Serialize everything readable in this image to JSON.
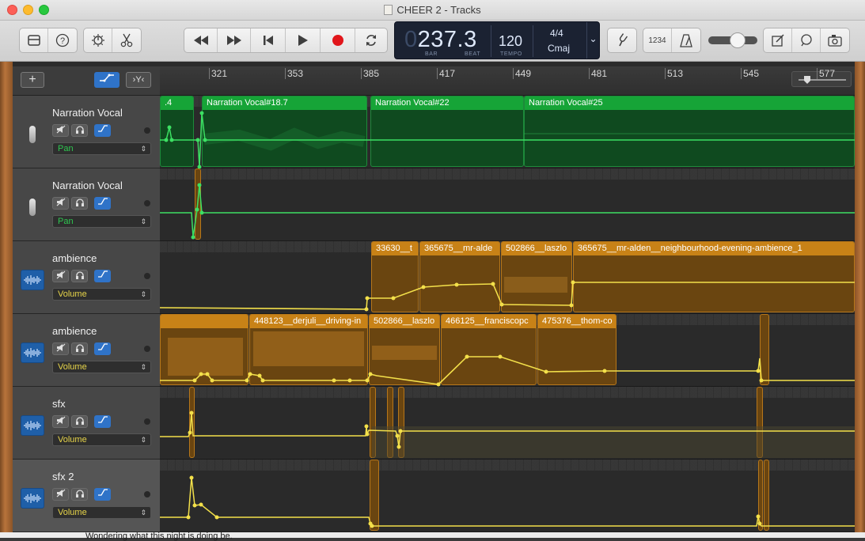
{
  "window": {
    "title": "CHEER 2 - Tracks"
  },
  "lcd": {
    "position_dim": "0",
    "position": "237.3",
    "bar_label": "BAR",
    "beat_label": "BEAT",
    "tempo": "120",
    "tempo_label": "TEMPO",
    "time_signature": "4/4",
    "key": "Cmaj"
  },
  "toolbar": {
    "count_in_label": "1234"
  },
  "ruler": {
    "bars": [
      "321",
      "353",
      "385",
      "417",
      "449",
      "481",
      "513",
      "545",
      "577"
    ]
  },
  "tracks": [
    {
      "name": "Narration Vocal",
      "param": "Pan",
      "param_color": "#2ec650",
      "icon": "mic-icon",
      "selected": false
    },
    {
      "name": "Narration Vocal",
      "param": "Pan",
      "param_color": "#2ec650",
      "icon": "mic-icon",
      "selected": false
    },
    {
      "name": "ambience",
      "param": "Volume",
      "param_color": "#e8d54a",
      "icon": "waveform-icon",
      "selected": false
    },
    {
      "name": "ambience",
      "param": "Volume",
      "param_color": "#e8d54a",
      "icon": "waveform-icon",
      "selected": false
    },
    {
      "name": "sfx",
      "param": "Volume",
      "param_color": "#e8d54a",
      "icon": "waveform-icon",
      "selected": false
    },
    {
      "name": "sfx 2",
      "param": "Volume",
      "param_color": "#e8d54a",
      "icon": "waveform-icon",
      "selected": true
    }
  ],
  "regions": {
    "lane1": [
      ".4",
      "Narration Vocal#18.7",
      "Narration Vocal#22",
      "Narration Vocal#25"
    ],
    "lane3": [
      "33630__t",
      "365675__mr-alde",
      "502866__laszlo",
      "365675__mr-alden__neighbourhood-evening-ambience_1"
    ],
    "lane4": [
      "448123__derjuli__driving-in",
      "502866__laszlo",
      "466125__franciscopc",
      "475376__thom-co"
    ]
  },
  "footer_text": "Wondering what this night is doing be."
}
